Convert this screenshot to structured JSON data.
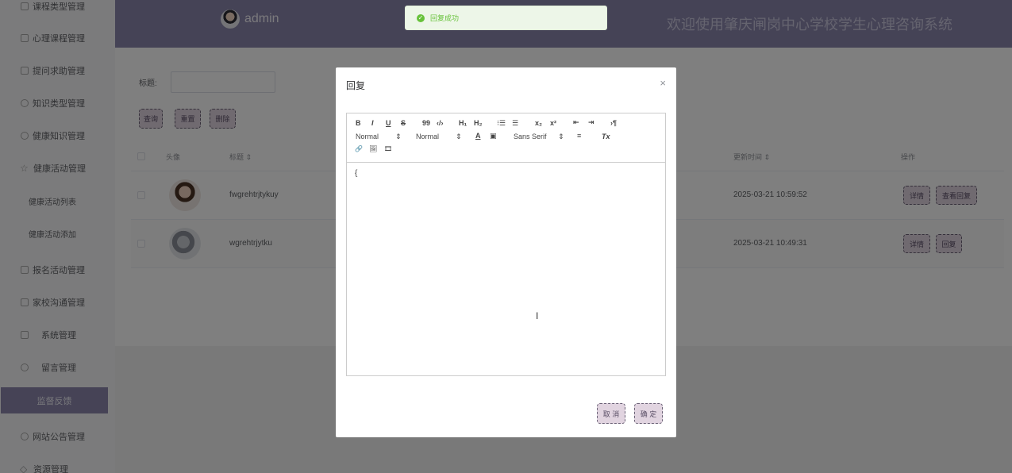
{
  "sidebar": {
    "items": [
      {
        "label": "课程类型管理",
        "icon": "checkbox-icon"
      },
      {
        "label": "心理课程管理",
        "icon": "calendar-icon"
      },
      {
        "label": "提问求助管理",
        "icon": "checkbox-icon"
      },
      {
        "label": "知识类型管理",
        "icon": "refresh-icon"
      },
      {
        "label": "健康知识管理",
        "icon": "clock-icon"
      },
      {
        "label": "健康活动管理",
        "icon": "star-icon"
      },
      {
        "label": "健康活动列表"
      },
      {
        "label": "健康活动添加"
      },
      {
        "label": "报名活动管理",
        "icon": "checkbox-icon"
      },
      {
        "label": "家校沟通管理",
        "icon": "calendar-icon"
      },
      {
        "label": "系统管理",
        "icon": "checkbox-icon"
      },
      {
        "label": "留言管理",
        "icon": "clock-icon"
      },
      {
        "label": "监督反馈",
        "active": true
      },
      {
        "label": "网站公告管理",
        "icon": "refresh-icon"
      },
      {
        "label": "资源管理",
        "icon": "diamond-icon"
      }
    ]
  },
  "header": {
    "username": "admin",
    "site_title": "欢迎使用肇庆闸岗中心学校学生心理咨询系统",
    "bg_color": "#8b86ad"
  },
  "toast": {
    "icon": "check-circle-icon",
    "text": "回复成功",
    "color": "#67c23a"
  },
  "search": {
    "title_label": "标题:",
    "title_value": ""
  },
  "buttons": {
    "query": "查询",
    "reset": "重置",
    "delete": "删除"
  },
  "table": {
    "headers": {
      "avatar": "头像",
      "title": "标题 ⇕",
      "updated": "更新时间 ⇕",
      "actions": "操作"
    },
    "rows": [
      {
        "title": "fwgrehtrjtykuy",
        "updated": "2025-03-21 10:59:52",
        "btn1": "详情",
        "btn2": "查看回复"
      },
      {
        "title": "wgrehtrjytku",
        "updated": "2025-03-21 10:49:31",
        "btn1": "详情",
        "btn2": "回复"
      }
    ]
  },
  "dialog": {
    "title": "回复",
    "close": "×",
    "toolbar": {
      "bold": "B",
      "italic": "I",
      "underline": "U",
      "strike": "S",
      "quote": "99",
      "code": "‹/›",
      "h1": "H₁",
      "h2": "H₂",
      "ordered_list": "⁝☰",
      "bullet_list": "☰",
      "sub": "x₂",
      "sup": "x²",
      "outdent": "⇤",
      "indent": "⇥",
      "direction": "›¶",
      "size": "Normal",
      "header": "Normal",
      "font": "Sans Serif",
      "color": "A",
      "background": "▣",
      "align": "≡",
      "clean": "Tx",
      "link": "🔗",
      "image": "🖼",
      "video": "🎞"
    },
    "content": "{",
    "cancel": "取 消",
    "confirm": "确 定"
  }
}
